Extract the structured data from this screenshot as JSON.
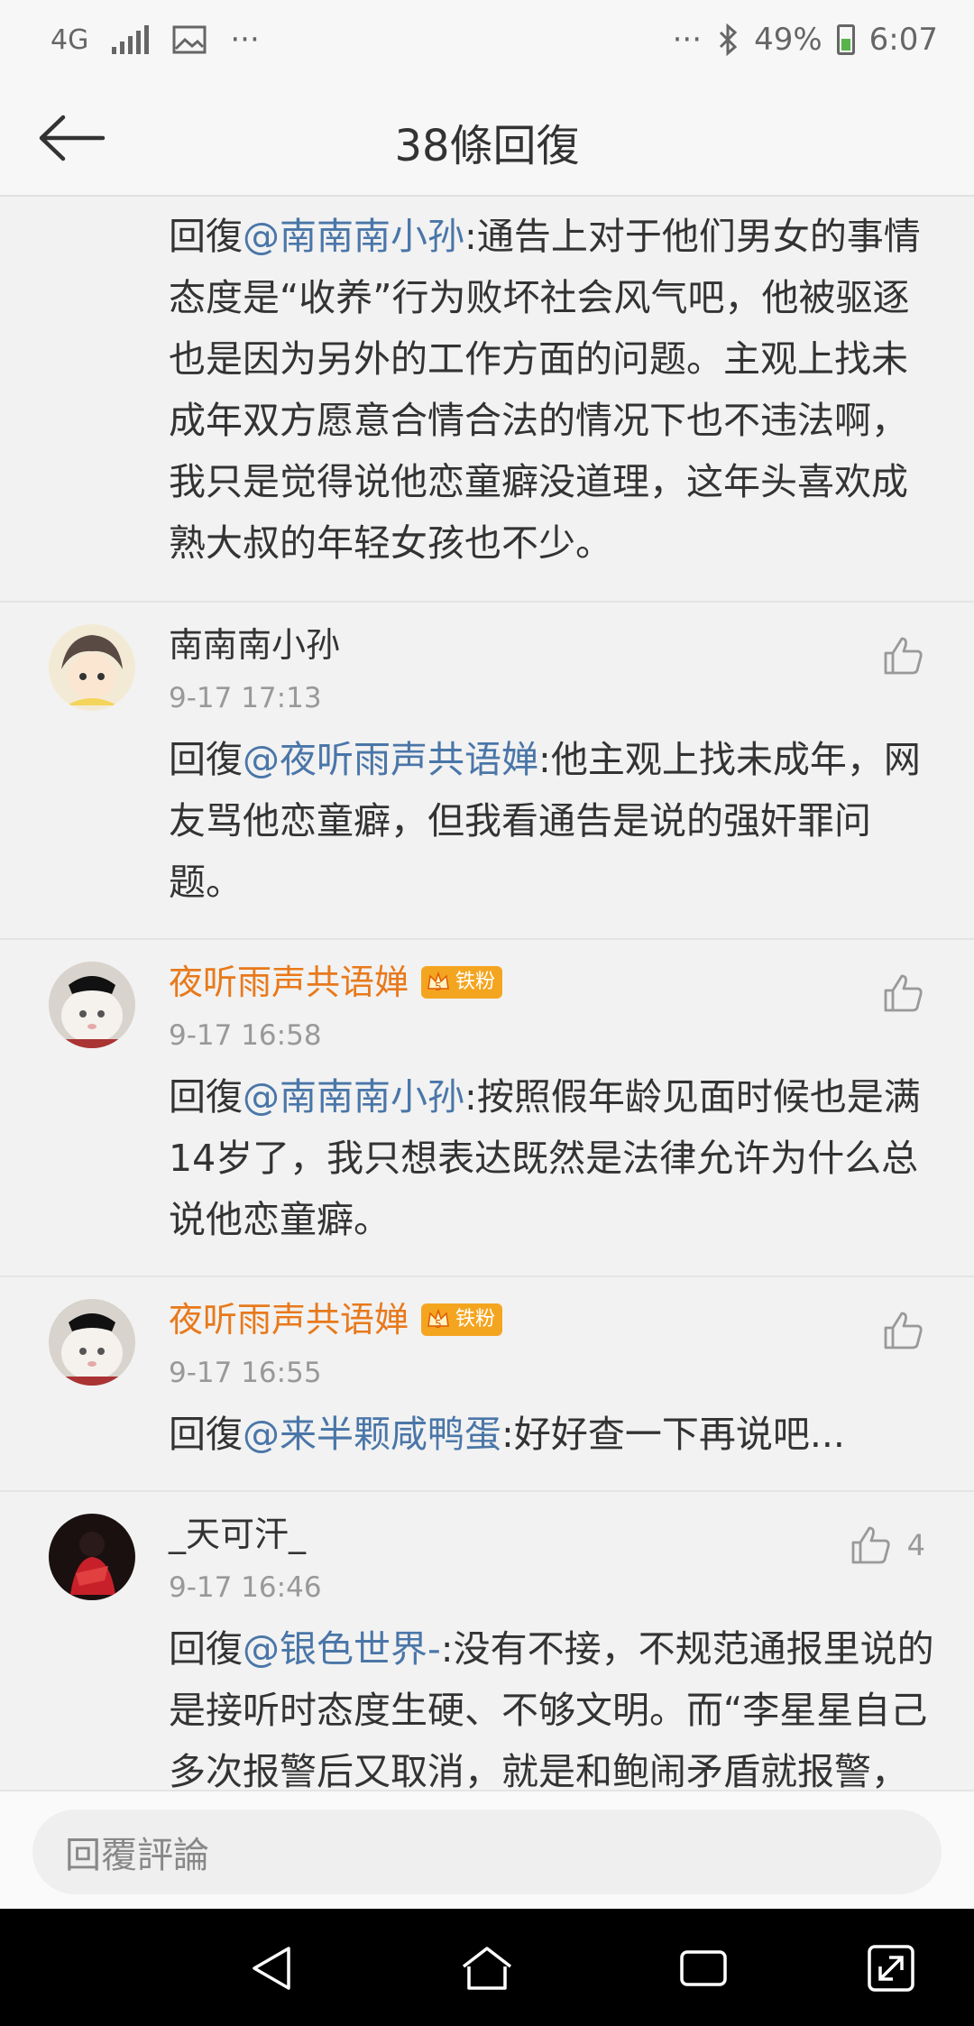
{
  "status_bar": {
    "network": "4G",
    "dots_left": "···",
    "dots_right": "···",
    "battery": "49%",
    "time": "6:07"
  },
  "header": {
    "title": "38條回復"
  },
  "first_comment": {
    "prefix": "回復",
    "mention": "@南南南小孙",
    "text": ":通告上对于他们男女的事情态度是“收养”行为败坏社会风气吧，他被驱逐也是因为另外的工作方面的问题。主观上找未成年双方愿意合情合法的情况下也不违法啊，我只是觉得说他恋童癖没道理，这年头喜欢成熟大叔的年轻女孩也不少。"
  },
  "comments": [
    {
      "username": "南南南小孙",
      "time": "9-17 17:13",
      "prefix": "回復",
      "mention": "@夜听雨声共语婵",
      "text": ":他主观上找未成年，网友骂他恋童癖，但我看通告是说的强奸罪问题。",
      "likes": ""
    },
    {
      "username": "夜听雨声共语婵",
      "badge": "铁粉",
      "badge_level": "5",
      "time": "9-17 16:58",
      "prefix": "回復",
      "mention": "@南南南小孙",
      "text": ":按照假年龄见面时候也是满14岁了，我只想表达既然是法律允许为什么总说他恋童癖。",
      "likes": ""
    },
    {
      "username": "夜听雨声共语婵",
      "badge": "铁粉",
      "badge_level": "5",
      "time": "9-17 16:55",
      "prefix": "回復",
      "mention": "@来半颗咸鸭蛋",
      "text": ":好好查一下再说吧...",
      "likes": ""
    },
    {
      "username": "_天可汗_",
      "time": "9-17 16:46",
      "prefix": "回復",
      "mention": "@银色世界-",
      "text": ":没有不接，不规范通报里说的是接听时态度生硬、不够文明。而“李星星自己多次报警后又取消，就是和鲍闹矛盾就报警，和好后就取消”……就算其回警方随便至",
      "likes": "4"
    }
  ],
  "reply_bar": {
    "placeholder": "回覆評論"
  },
  "colors": {
    "mention": "#4a76a8",
    "vip_name": "#e8791b",
    "badge": "#f4a520"
  }
}
